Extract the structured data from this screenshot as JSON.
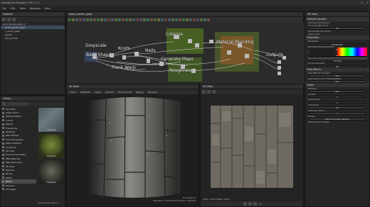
{
  "app": {
    "title": "Substance Designer 2017.1.0"
  },
  "menu": [
    "File",
    "Edit",
    "Tools",
    "Windows",
    "Help"
  ],
  "explorer": {
    "title": "Explorer",
    "items": [
      "wood_planks_aged_2",
      "wood_planks_aged",
      "1_wood_plank",
      "planks",
      "wood_knots"
    ]
  },
  "graph": {
    "tab": "wood_planks_aged",
    "labels": {
      "greyscale": "Greyscale",
      "colorize": "Colorize",
      "knots": "Knots",
      "base_shape": "Base Shape",
      "nails": "Nails",
      "material_blending": "Material Blending",
      "outputs": "Outputs",
      "plank_warp": "Plank Warp",
      "generate_maps": "Generate Maps",
      "roughness": "Roughness"
    }
  },
  "library": {
    "title": "Library",
    "categories": [
      "Favorites",
      "Graph Items",
      "Material Filters",
      "1-Click",
      "Effects",
      "Transforms",
      "Blending",
      "PBR Utilities",
      "Scan Processing",
      "Mesh Adaptive",
      "Functions",
      "3D View",
      "Environment Maps",
      "PBR Materials",
      "MDL Resources",
      "2D View",
      "Patterns",
      "Bricks",
      "Utility",
      "Wood",
      "Textures",
      "Smudges"
    ],
    "selected": "Wood",
    "thumbs": [
      "Tree Bark",
      "Tree Bark",
      "Tree Bark"
    ],
    "footer": "wood_planks_aged_2"
  },
  "view3d": {
    "title": "3D View",
    "menus": [
      "Scene",
      "Materials",
      "Lights",
      "Camera",
      "Environment",
      "Display",
      "Renderer"
    ],
    "stats_line1": "Resolution: 1024x1024",
    "stats_line2": "Iterations: 128/128",
    "stats_line3": "Preview/Final"
  },
  "view2d": {
    "title": "2D View",
    "footer_info": "2048 x 2048 (RGBA, 16bpc)",
    "zoom": "1:1"
  },
  "properties": {
    "title": "3D View",
    "sections": [
      {
        "head": "Default Camera",
        "rows": [
          {
            "label": "Camera Component",
            "value": ""
          },
          {
            "label": "Focal Length (mm)",
            "value": "50"
          },
          {
            "label": "Horizontal Film Plane",
            "value": ""
          },
          {
            "label": "Clear Color",
            "value": ""
          }
        ]
      },
      {
        "head": "Projection",
        "rows": [
          {
            "label": "Projection",
            "value": "Perspective"
          },
          {
            "label": "Near/Window Resolution",
            "value": "True"
          },
          {
            "label": "Resolution",
            "value": "1.0"
          },
          {
            "label": "Focus Distance",
            "value": "1.0 Units"
          },
          {
            "label": "Focus Diameter",
            "value": "0.0"
          }
        ]
      },
      {
        "head": "Post Effects",
        "rows": [
          {
            "label": "Post Effects Enabled",
            "value": "True"
          },
          {
            "label": "Isomorphic Lens Flare Enabled",
            "value": "True"
          }
        ]
      },
      {
        "head": "Glare",
        "rows": [
          {
            "label": "Enabled",
            "value": "True"
          },
          {
            "label": "Quality",
            "value": "4"
          },
          {
            "label": "Luminance",
            "value": "1"
          },
          {
            "label": "Threshold",
            "value": "0.5"
          },
          {
            "label": "Intensity Factor",
            "value": "1"
          },
          {
            "label": "Shape",
            "value": "Star Cross Linear Spectral"
          },
          {
            "label": "Star Number Shape",
            "value": ""
          }
        ]
      }
    ]
  },
  "colors": {
    "accent": "#3c4a5e",
    "node_green": "#6a9a2a",
    "node_orange": "#c8783a"
  }
}
